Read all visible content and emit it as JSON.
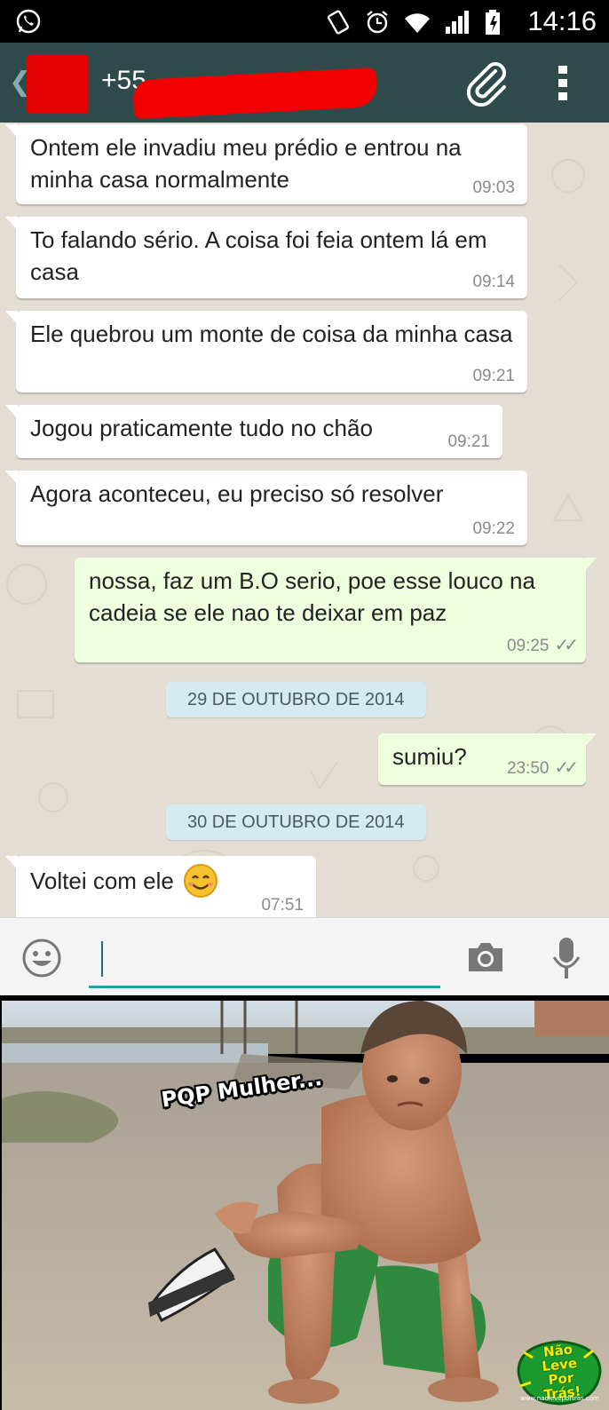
{
  "status_bar": {
    "time": "14:16"
  },
  "header": {
    "contact_prefix": "+55"
  },
  "messages": [
    {
      "direction": "in",
      "text": "Ontem ele invadiu meu prédio e entrou na minha casa normalmente",
      "time": "09:03"
    },
    {
      "direction": "in",
      "text": "To falando sério. A coisa foi feia ontem lá em casa",
      "time": "09:14"
    },
    {
      "direction": "in",
      "text": "Ele quebrou um monte de coisa da minha casa",
      "time": "09:21"
    },
    {
      "direction": "in",
      "text": "Jogou praticamente tudo no chão",
      "time": "09:21"
    },
    {
      "direction": "in",
      "text": "Agora aconteceu, eu preciso só resolver",
      "time": "09:22"
    },
    {
      "direction": "out",
      "text": "nossa, faz um B.O serio, poe esse louco na cadeia se ele nao te deixar em paz",
      "time": "09:25",
      "status": "read"
    },
    {
      "direction": "date",
      "text": "29 DE OUTUBRO DE 2014"
    },
    {
      "direction": "out",
      "text": "sumiu?",
      "time": "23:50",
      "status": "read"
    },
    {
      "direction": "date",
      "text": "30 DE OUTUBRO DE 2014"
    },
    {
      "direction": "in",
      "text": "Voltei com ele",
      "emoji": "smiling-face",
      "time": "07:51"
    }
  ],
  "composer": {
    "placeholder": ""
  },
  "meme": {
    "caption": "PQP Mulher...",
    "watermark": "Não Leve Por Trás!",
    "watermark_url": "www.naoleveportras.com"
  },
  "colors": {
    "app_bar": "#2f4a4a",
    "chat_background": "#e4ddd3",
    "incoming_bubble": "#ffffff",
    "outgoing_bubble": "#eeffde",
    "date_chip": "#d6eaf3",
    "redaction": "#f20000",
    "accent": "#1ea3a8"
  },
  "icons": {
    "status_app": "whatsapp-icon",
    "status_right": [
      "vibrate-icon",
      "alarm-icon",
      "wifi-icon",
      "signal-icon",
      "battery-icon"
    ],
    "header": [
      "back-icon",
      "attach-icon",
      "overflow-menu-icon"
    ],
    "composer": [
      "emoji-icon",
      "camera-icon",
      "mic-icon"
    ]
  }
}
